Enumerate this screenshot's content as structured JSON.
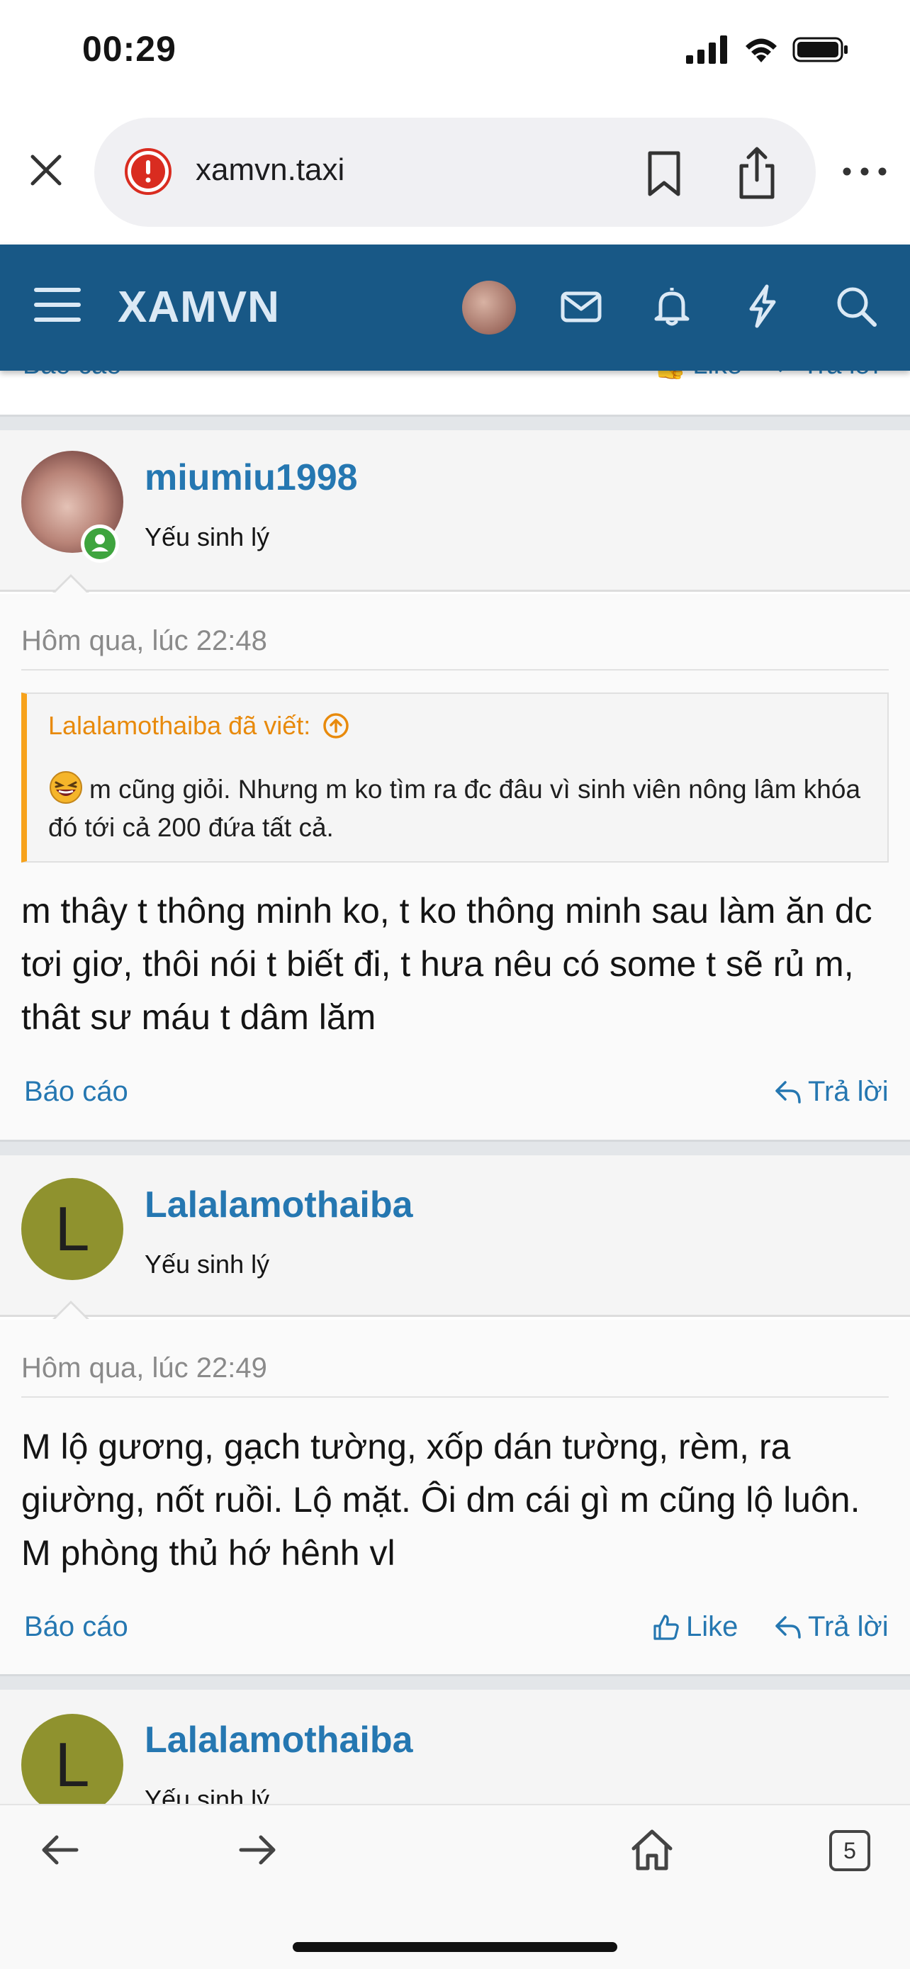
{
  "status_bar": {
    "time": "00:29"
  },
  "browser": {
    "url": "xamvn.taxi",
    "tab_count": "5"
  },
  "site": {
    "logo": "XAMVN"
  },
  "previous_post": {
    "report_label": "Báo cáo",
    "like_label": "Like",
    "reply_label": "Trả lời"
  },
  "posts": [
    {
      "username": "miumiu1998",
      "user_title": "Yếu sinh lý",
      "date": "Hôm qua, lúc 22:48",
      "quote": {
        "author_line": "Lalalamothaiba đã viết:",
        "text": "m cũng giỏi. Nhưng m ko tìm ra đc đâu vì sinh viên nông lâm khóa đó tới cả 200 đứa tất cả."
      },
      "message": "m thây t thông minh ko, t ko thông minh sau làm ăn dc tơi giơ, thôi nói t biết đi, t hưa nêu có some t sẽ rủ m, thât sư máu t dâm lăm",
      "report_label": "Báo cáo",
      "reply_label": "Trả lời"
    },
    {
      "username": "Lalalamothaiba",
      "avatar_letter": "L",
      "user_title": "Yếu sinh lý",
      "date": "Hôm qua, lúc 22:49",
      "message": "M lộ gương, gạch tường, xốp dán tường, rèm, ra giường, nốt ruồi. Lộ mặt. Ôi dm cái gì m cũng lộ luôn. M phòng thủ hớ hênh vl",
      "report_label": "Báo cáo",
      "like_label": "Like",
      "reply_label": "Trả lời"
    },
    {
      "username": "Lalalamothaiba",
      "avatar_letter": "L",
      "user_title": "Yếu sinh lý"
    }
  ],
  "colors": {
    "header_bg": "#185886",
    "link": "#2577b1",
    "quote_accent": "#f7a21b",
    "avatar_bg": "#8f922e",
    "online_badge": "#3ea43e"
  }
}
